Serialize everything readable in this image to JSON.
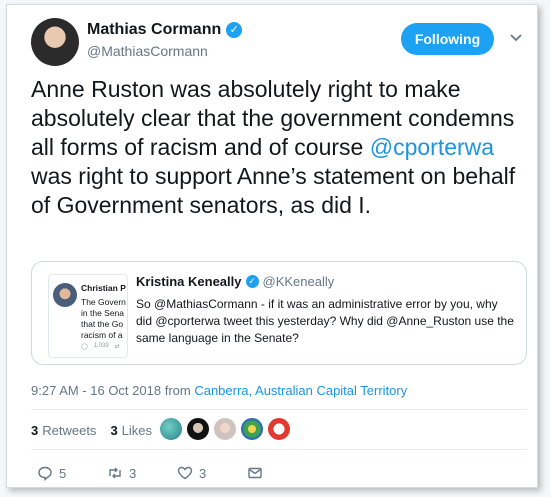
{
  "header": {
    "name": "Mathias Cormann",
    "handle": "@MathiasCormann",
    "follow_label": "Following"
  },
  "tweet": {
    "text_before": "Anne Ruston was absolutely right to make absolutely clear that the government condemns all forms of racism and of course ",
    "mention": "@cporterwa",
    "text_after": " was right to support Anne’s statement on behalf of Government senators, as did I."
  },
  "quote": {
    "name": "Kristina Keneally",
    "handle": "@KKeneally",
    "text": "So @MathiasCormann - if it was an administrative error by you, why did @cporterwa tweet this yesterday?  Why did @Anne_Ruston use the same language in the Senate?",
    "thumb_name": "Christian P",
    "thumb_lines": [
      "The Govern",
      "in the Sena",
      "that the Go",
      "racism of a"
    ],
    "thumb_count": "1,039"
  },
  "meta": {
    "time": "9:27 AM - 16 Oct 2018",
    "from": "from",
    "location": "Canberra, Australian Capital Territory"
  },
  "stats": {
    "retweets_count": "3",
    "retweets_label": "Retweets",
    "likes_count": "3",
    "likes_label": "Likes"
  },
  "actions": {
    "replies": "5",
    "retweets": "3",
    "likes": "3"
  },
  "colors": {
    "accent": "#1da1f2",
    "link": "#1b95e0",
    "muted": "#657786"
  }
}
